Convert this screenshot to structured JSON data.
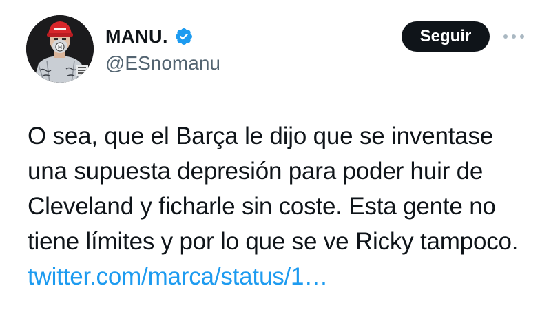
{
  "author": {
    "display_name": "MANU.",
    "username": "@ESnomanu",
    "verified": true,
    "verified_color": "#1d9bf0"
  },
  "actions": {
    "follow_label": "Seguir",
    "more_icon": "more-horizontal-icon"
  },
  "tweet": {
    "text": "O sea, que el Barça le dijo que se inventase una supuesta depresión para poder huir de Cleveland y ficharle sin coste. Esta gente no tiene límites y por lo que se ve Ricky tampoco.",
    "link_text": "twitter.com/marca/status/1…",
    "link_color": "#1d9bf0"
  },
  "colors": {
    "text_primary": "#0f1419",
    "text_secondary": "#536471",
    "button_bg": "#0f1419",
    "button_text": "#ffffff"
  }
}
